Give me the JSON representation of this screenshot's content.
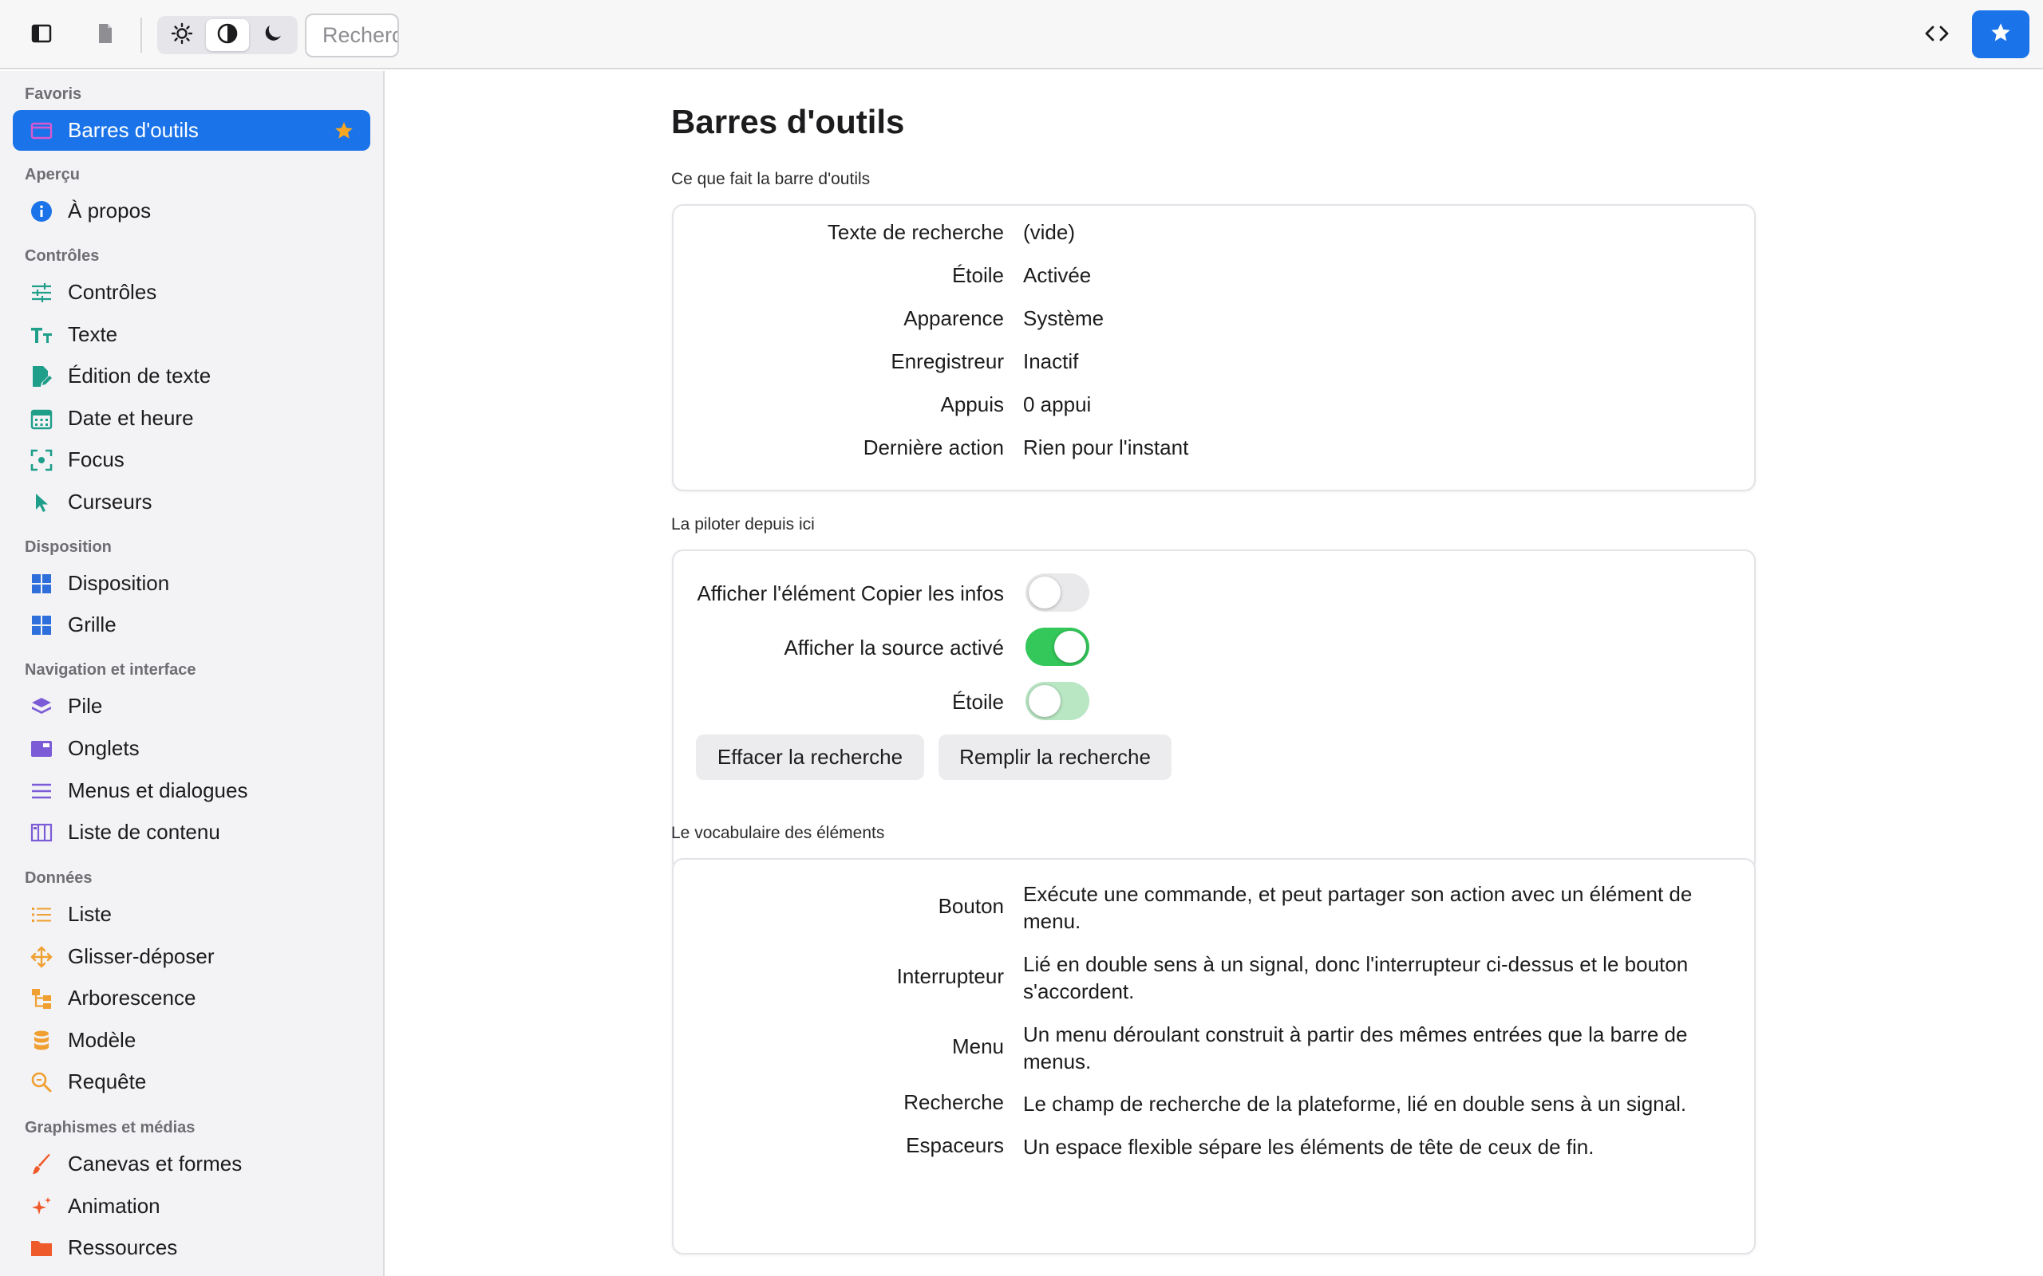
{
  "toolbar": {
    "search_placeholder": "Rechercher",
    "search_value": "",
    "appearance_selected": "system",
    "icons": {
      "sidebar": "sidebar-toggle-icon",
      "document": "document-icon",
      "light": "sun-icon",
      "system": "half-circle-icon",
      "dark": "moon-icon",
      "code": "code-icon",
      "star": "star-icon"
    }
  },
  "colors": {
    "accent": "#1a73e8",
    "toggle_on": "#34c759",
    "favorite_star": "#f6a623",
    "teal": "#1f9e8a",
    "violet": "#7b5cd6",
    "orange": "#f0a030",
    "red_orange": "#ef5a2a"
  },
  "sidebar": {
    "sections": [
      {
        "title": "Favoris",
        "items": [
          {
            "label": "Barres d'outils",
            "icon": "window-icon",
            "selected": true,
            "favorite": true
          }
        ]
      },
      {
        "title": "Aperçu",
        "items": [
          {
            "label": "À propos",
            "icon": "info-icon"
          }
        ]
      },
      {
        "title": "Contrôles",
        "items": [
          {
            "label": "Contrôles",
            "icon": "sliders-icon"
          },
          {
            "label": "Texte",
            "icon": "text-size-icon"
          },
          {
            "label": "Édition de texte",
            "icon": "edit-doc-icon"
          },
          {
            "label": "Date et heure",
            "icon": "calendar-icon"
          },
          {
            "label": "Focus",
            "icon": "focus-icon"
          },
          {
            "label": "Curseurs",
            "icon": "pointer-icon"
          }
        ]
      },
      {
        "title": "Disposition",
        "items": [
          {
            "label": "Disposition",
            "icon": "layout-icon"
          },
          {
            "label": "Grille",
            "icon": "grid-icon"
          }
        ]
      },
      {
        "title": "Navigation et interface",
        "items": [
          {
            "label": "Pile",
            "icon": "stack-icon"
          },
          {
            "label": "Onglets",
            "icon": "tabs-icon"
          },
          {
            "label": "Menus et dialogues",
            "icon": "menu-lines-icon"
          },
          {
            "label": "Liste de contenu",
            "icon": "columns-icon"
          }
        ]
      },
      {
        "title": "Données",
        "items": [
          {
            "label": "Liste",
            "icon": "list-icon"
          },
          {
            "label": "Glisser-déposer",
            "icon": "move-icon"
          },
          {
            "label": "Arborescence",
            "icon": "tree-icon"
          },
          {
            "label": "Modèle",
            "icon": "database-icon"
          },
          {
            "label": "Requête",
            "icon": "magnifier-icon"
          }
        ]
      },
      {
        "title": "Graphismes et médias",
        "items": [
          {
            "label": "Canevas et formes",
            "icon": "brush-icon"
          },
          {
            "label": "Animation",
            "icon": "sparkle-icon"
          },
          {
            "label": "Ressources",
            "icon": "folder-icon"
          }
        ]
      }
    ]
  },
  "main": {
    "title": "Barres d'outils",
    "status": {
      "heading": "Ce que fait la barre d'outils",
      "rows": [
        {
          "key": "Texte de recherche",
          "value": "(vide)"
        },
        {
          "key": "Étoile",
          "value": "Activée"
        },
        {
          "key": "Apparence",
          "value": "Système"
        },
        {
          "key": "Enregistreur",
          "value": "Inactif"
        },
        {
          "key": "Appuis",
          "value": "0 appui"
        },
        {
          "key": "Dernière action",
          "value": "Rien pour l'instant"
        }
      ]
    },
    "controls": {
      "heading": "La piloter depuis ici",
      "toggles": [
        {
          "label": "Afficher l'élément Copier les infos",
          "on": false
        },
        {
          "label": "Afficher la source activé",
          "on": true
        },
        {
          "label": "Étoile",
          "on": false
        }
      ],
      "buttons": {
        "clear": "Effacer la recherche",
        "fill": "Remplir la recherche"
      }
    },
    "vocab": {
      "heading": "Le vocabulaire des éléments",
      "rows": [
        {
          "key": "Bouton",
          "value": "Exécute une commande, et peut partager son action avec un élément de menu."
        },
        {
          "key": "Interrupteur",
          "value": "Lié en double sens à un signal, donc l'interrupteur ci-dessus et le bouton s'accordent."
        },
        {
          "key": "Menu",
          "value": "Un menu déroulant construit à partir des mêmes entrées que la barre de menus."
        },
        {
          "key": "Recherche",
          "value": "Le champ de recherche de la plateforme, lié en double sens à un signal."
        },
        {
          "key": "Espaceurs",
          "value": "Un espace flexible sépare les éléments de tête de ceux de fin."
        }
      ]
    }
  }
}
